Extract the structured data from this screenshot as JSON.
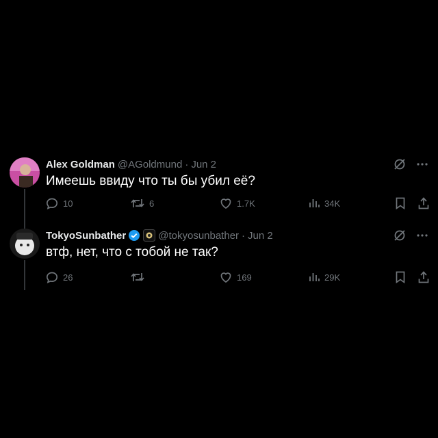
{
  "tweets": [
    {
      "name": "Alex Goldman",
      "handle": "@AGoldmund",
      "date": "Jun 2",
      "text": "Имеешь ввиду что ты бы убил её?",
      "replies": "10",
      "reposts": "6",
      "likes": "1.7K",
      "views": "34K",
      "verified": false
    },
    {
      "name": "TokyoSunbather",
      "handle": "@tokyosunbather",
      "date": "Jun 2",
      "text": "втф, нет, что с тобой не так?",
      "replies": "26",
      "reposts": "",
      "likes": "169",
      "views": "29K",
      "verified": true
    }
  ],
  "separator": "·",
  "colors": {
    "background": "#000000",
    "text": "#e7e9ea",
    "muted": "#71767b",
    "verified_badge": "#1d9bf0",
    "thread_line": "#333639"
  },
  "icons": [
    "reply-icon",
    "repost-icon",
    "like-icon",
    "views-icon",
    "bookmark-icon",
    "share-icon",
    "grok-icon",
    "more-icon",
    "verified-badge-icon"
  ]
}
